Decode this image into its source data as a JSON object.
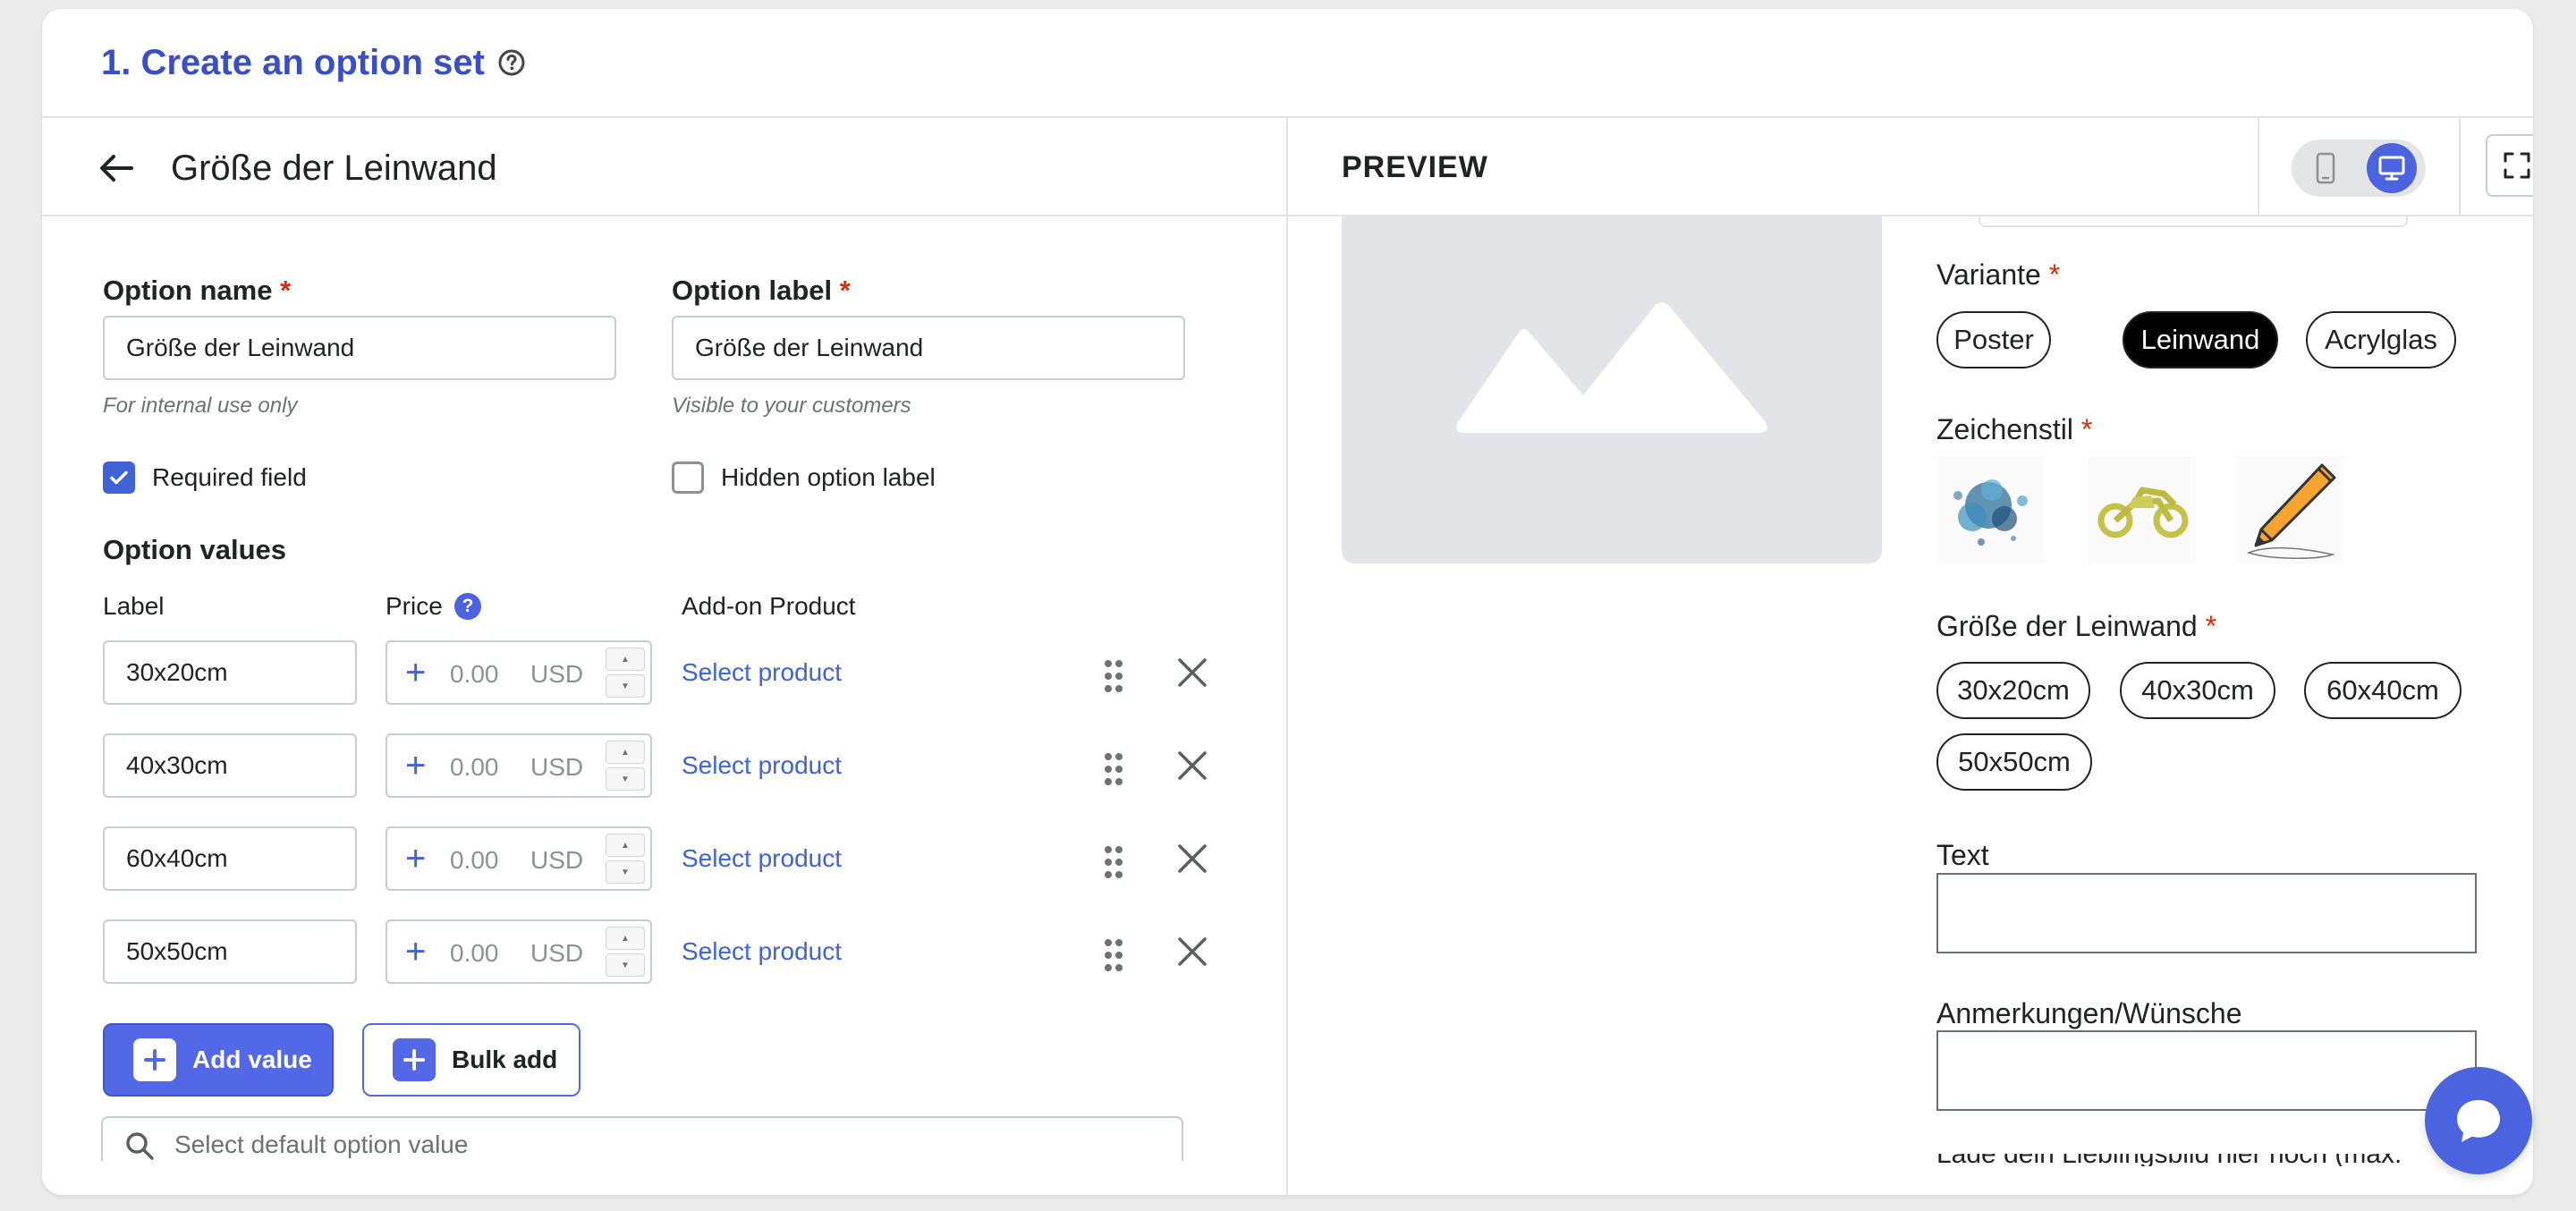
{
  "header": {
    "title": "1. Create an option set"
  },
  "editor": {
    "title": "Größe der Leinwand",
    "option_name": {
      "label": "Option name",
      "required_mark": "*",
      "value": "Größe der Leinwand",
      "hint": "For internal use only"
    },
    "option_label": {
      "label": "Option label",
      "required_mark": "*",
      "value": "Größe der Leinwand",
      "hint": "Visible to your customers"
    },
    "required_field": {
      "label": "Required field",
      "checked": true
    },
    "hidden_option_label": {
      "label": "Hidden option label",
      "checked": false
    },
    "values_heading": "Option values",
    "columns": {
      "label": "Label",
      "price": "Price",
      "addon": "Add-on Product"
    },
    "rows": [
      {
        "label": "30x20cm",
        "price": "0.00",
        "currency": "USD",
        "addon": "Select product"
      },
      {
        "label": "40x30cm",
        "price": "0.00",
        "currency": "USD",
        "addon": "Select product"
      },
      {
        "label": "60x40cm",
        "price": "0.00",
        "currency": "USD",
        "addon": "Select product"
      },
      {
        "label": "50x50cm",
        "price": "0.00",
        "currency": "USD",
        "addon": "Select product"
      }
    ],
    "add_value": "Add value",
    "bulk_add": "Bulk add",
    "default_placeholder": "Select default option value"
  },
  "preview": {
    "title": "PREVIEW",
    "variante": {
      "label": "Variante",
      "required_mark": "*",
      "options": [
        "Poster",
        "Leinwand",
        "Acrylglas"
      ],
      "selected": "Leinwand"
    },
    "zeichenstil": {
      "label": "Zeichenstil",
      "required_mark": "*",
      "swatches": [
        "watercolor-splash",
        "motorcycle",
        "pencil"
      ]
    },
    "groesse": {
      "label": "Größe der Leinwand",
      "required_mark": "*",
      "options": [
        "30x20cm",
        "40x30cm",
        "60x40cm",
        "50x50cm"
      ]
    },
    "text_field": {
      "label": "Text"
    },
    "notes_field": {
      "label": "Anmerkungen/Wünsche"
    },
    "cutoff_text": "Lade dein Lieblingsbild hier hoch (max."
  },
  "colors": {
    "accent": "#4b63de",
    "title": "#3b4fc4",
    "required": "#d72c0d"
  }
}
